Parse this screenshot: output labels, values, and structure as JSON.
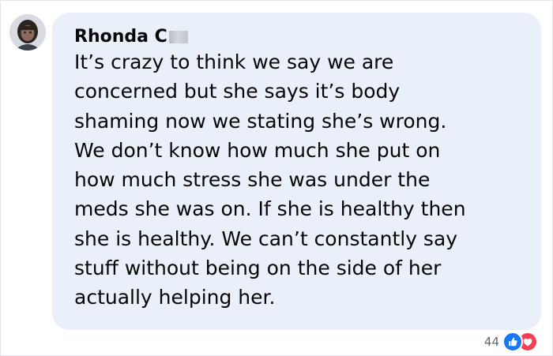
{
  "comment": {
    "author": "Rhonda C",
    "text_lines": [
      "It’s crazy to think we say we are",
      "concerned but she says it’s body",
      "shaming now we stating she’s wrong.",
      "We don’t know how much she put on",
      "how much stress she was under the",
      "meds she was on. If she is healthy then",
      "she is healthy. We can’t constantly say",
      "stuff without being on the side of her",
      "actually helping her."
    ]
  },
  "reactions": {
    "count": "44",
    "icons": [
      "like-icon",
      "love-icon"
    ]
  },
  "colors": {
    "bubble_bg": "#eaf0f9",
    "text": "#050505",
    "like": "#1877f2",
    "love": "#f33e58"
  }
}
